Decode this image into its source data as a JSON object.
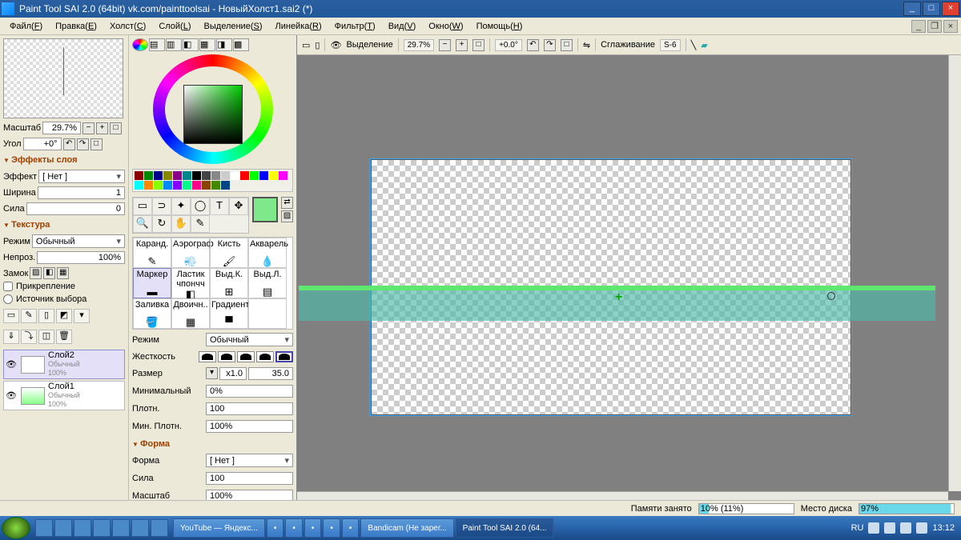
{
  "title": "Paint Tool SAI 2.0 (64bit) vk.com/painttoolsai - НовыйХолст1.sai2 (*)",
  "menu": [
    "Файл(F)",
    "Правка(E)",
    "Холст(C)",
    "Слой(L)",
    "Выделение(S)",
    "Линейка(R)",
    "Фильтр(T)",
    "Вид(V)",
    "Окно(W)",
    "Помощь(H)"
  ],
  "nav": {
    "scale_lbl": "Масштаб",
    "scale": "29.7%",
    "angle_lbl": "Угол",
    "angle": "+0°"
  },
  "fx": {
    "hdr": "Эффекты слоя",
    "effect_lbl": "Эффект",
    "effect": "[ Нет ]",
    "width_lbl": "Ширина",
    "width": "1",
    "str_lbl": "Сила",
    "str": "0"
  },
  "tex": {
    "hdr": "Текстура",
    "mode_lbl": "Режим",
    "mode": "Обычный",
    "opac_lbl": "Непроз.",
    "opac": "100%",
    "lock_lbl": "Замок",
    "pin": "Прикрепление",
    "src": "Источник выбора"
  },
  "layers": [
    {
      "name": "Слой2",
      "mode": "Обычный",
      "op": "100%",
      "sel": true
    },
    {
      "name": "Слой1",
      "mode": "Обычный",
      "op": "100%",
      "sel": false
    }
  ],
  "brushes": [
    "Каранд.",
    "Аэрограф",
    "Кисть",
    "Акварель",
    "Маркер",
    "Ластик чпончч",
    "Выд.К.",
    "Выд.Л.",
    "Заливка",
    "Двоичн..",
    "Градиент",
    ""
  ],
  "brush_sel": 4,
  "props": {
    "mode_lbl": "Режим",
    "mode": "Обычный",
    "hard_lbl": "Жесткость",
    "size_lbl": "Размер",
    "size_mult": "x1.0",
    "size": "35.0",
    "min_lbl": "Минимальный",
    "min": "0%",
    "dens_lbl": "Плотн.",
    "dens": "100",
    "mind_lbl": "Мин. Плотн.",
    "mind": "100%",
    "shape_hdr": "Форма",
    "shape_lbl": "Форма",
    "shape": "[ Нет ]",
    "sstr_lbl": "Сила",
    "sstr": "100",
    "sscale_lbl": "Масштаб",
    "sscale": "100%"
  },
  "topbar": {
    "sel": "Выделение",
    "zoom": "29.7%",
    "ang": "+0.0°",
    "smooth_lbl": "Сглаживание",
    "smooth": "S-6"
  },
  "doc": {
    "name": "НовыйХолст1.sai2",
    "zoom": "30%"
  },
  "status": {
    "mem_lbl": "Памяти занято",
    "mem": "10% (11%)",
    "mem_pct": 10,
    "disk_lbl": "Место диска",
    "disk": "97%",
    "disk_pct": 97
  },
  "taskbar": {
    "items": [
      "YouTube — Яндекс...",
      "",
      "",
      "",
      "",
      "",
      "Bandicam (Не зарег...",
      "Paint Tool SAI 2.0 (64..."
    ],
    "lang": "RU",
    "time": "13:12"
  },
  "swatch_colors": [
    "#800",
    "#080",
    "#008",
    "#880",
    "#808",
    "#088",
    "#000",
    "#444",
    "#888",
    "#ccc",
    "#fff",
    "#f00",
    "#0f0",
    "#00f",
    "#ff0",
    "#f0f",
    "#0ff",
    "#f80",
    "#8f0",
    "#08f",
    "#80f",
    "#0f8",
    "#f08",
    "#840",
    "#480",
    "#048"
  ]
}
